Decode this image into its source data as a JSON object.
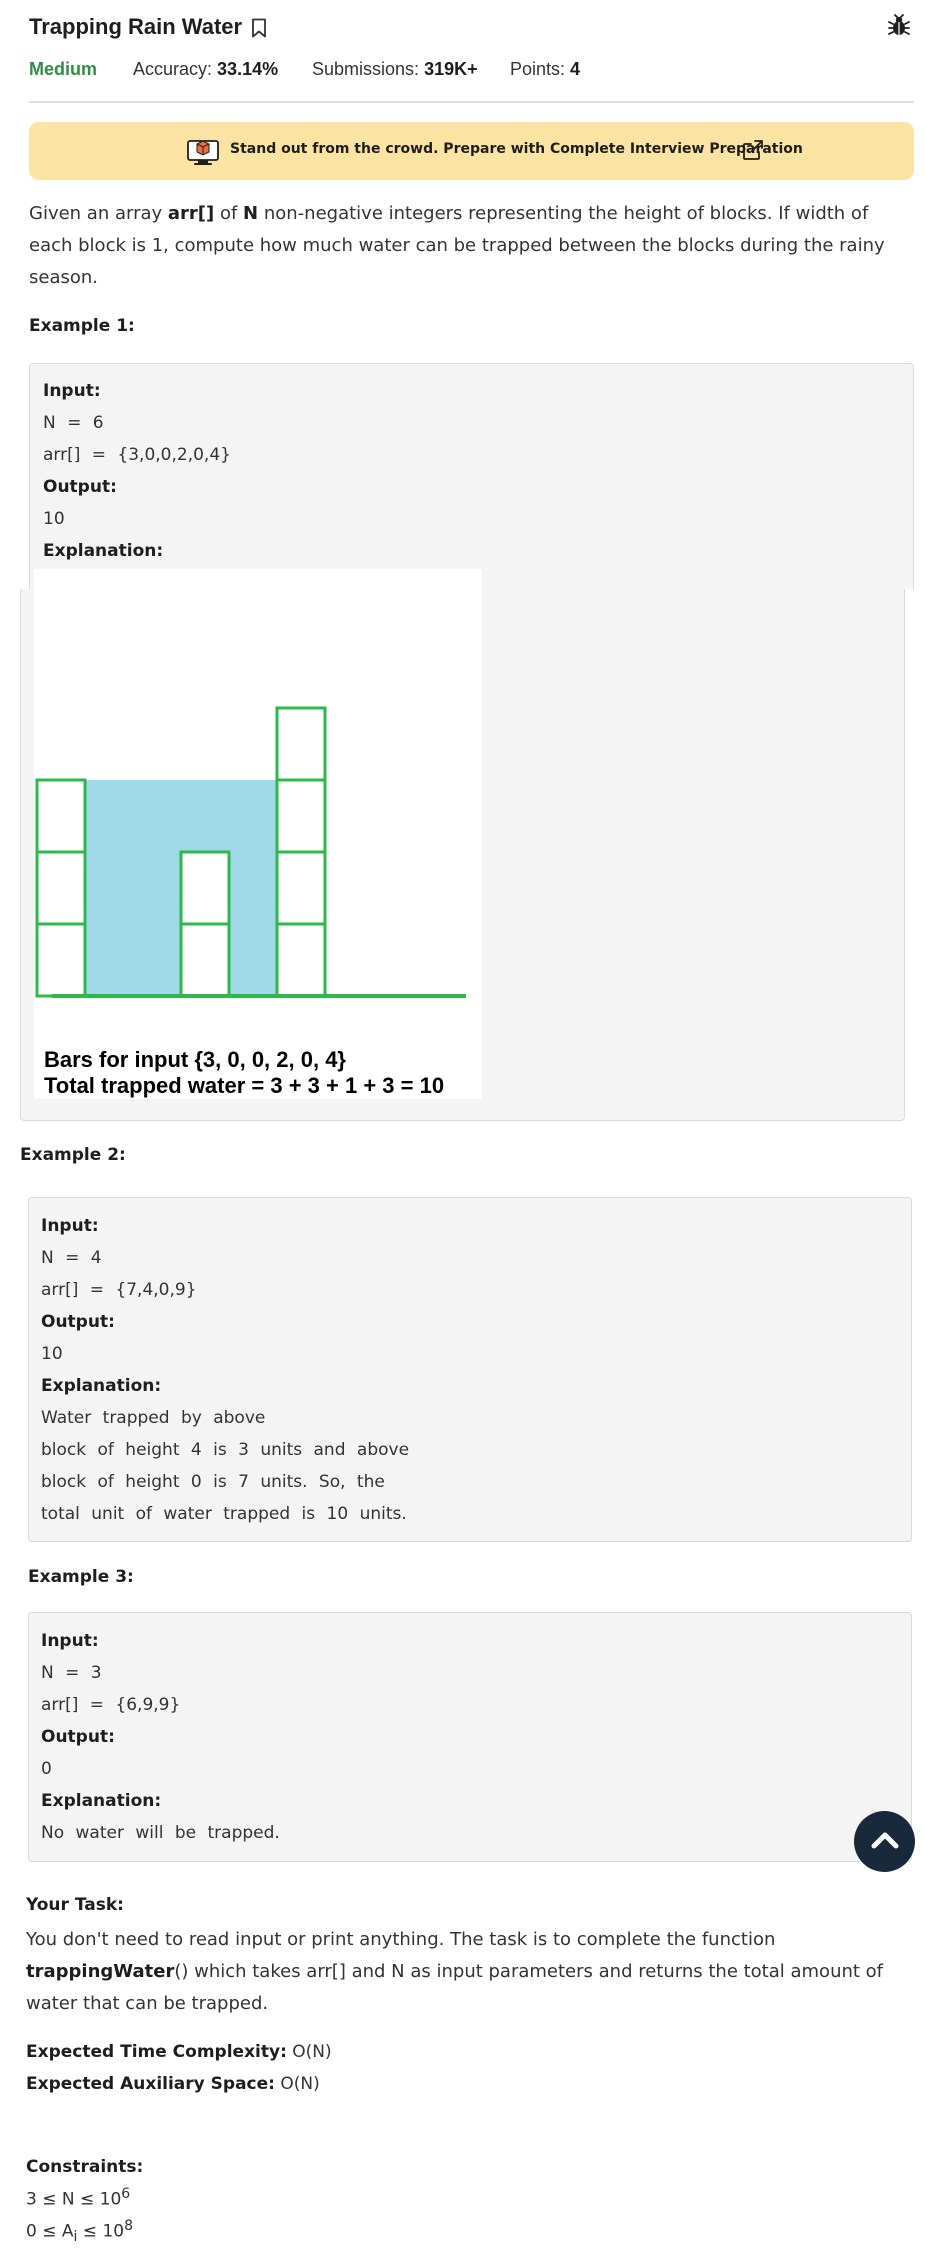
{
  "header": {
    "title": "Trapping Rain Water",
    "difficulty": "Medium",
    "accuracy_label": "Accuracy:",
    "accuracy_value": "33.14%",
    "submissions_label": "Submissions:",
    "submissions_value": "319K+",
    "points_label": "Points:",
    "points_value": "4"
  },
  "banner": {
    "text": "Stand out from the crowd. Prepare with Complete Interview Preparation"
  },
  "description": {
    "part1": "Given an array ",
    "arr": "arr[]",
    "part2": " of ",
    "n": "N",
    "part3": " non-negative integers representing the height of blocks. If width of each block is 1, compute how much water can be trapped between the blocks during the rainy season."
  },
  "labels": {
    "input": "Input:",
    "output": "Output:",
    "explanation": "Explanation:"
  },
  "example1": {
    "title": "Example 1:",
    "n_line": "N = 6",
    "arr_line": "arr[] = {3,0,0,2,0,4}",
    "output": "10",
    "figure": {
      "heights": [
        3,
        0,
        0,
        2,
        0,
        4
      ],
      "water_level": 3,
      "caption1": "Bars for input {3, 0, 0, 2, 0, 4}",
      "caption2": "Total trapped water = 3 + 3 + 1 + 3 = 10",
      "block_color": "#2eb84c",
      "water_color": "#9fd9e8"
    }
  },
  "example2": {
    "title": "Example 2:",
    "n_line": "N = 4",
    "arr_line": "arr[] = {7,4,0,9}",
    "output": "10",
    "explanation_lines": [
      "Water trapped by above",
      "block of height 4 is 3 units and above",
      "block of height 0 is 7 units. So, the",
      "total unit of water trapped is 10 units."
    ]
  },
  "example3": {
    "title": "Example 3:",
    "n_line": "N = 3",
    "arr_line": "arr[] = {6,9,9}",
    "output": "0",
    "explanation": "No water will be trapped."
  },
  "task": {
    "title": "Your Task:",
    "part1": "You don't need to read input or print anything. The task is to complete the function ",
    "function": "trappingWater",
    "part2": "() which takes arr[] and N as input parameters and returns the total amount of water that can be trapped."
  },
  "complexity": {
    "time_label": "Expected Time Complexity:",
    "time_value": "O(N)",
    "space_label": "Expected Auxiliary Space:",
    "space_value": "O(N)"
  },
  "constraints": {
    "title": "Constraints:",
    "c1_pre": "3 ≤ N ≤ 10",
    "c1_exp": "6",
    "c2_a": "0 ≤ A",
    "c2_sub": "i",
    "c2_b": " ≤ 10",
    "c2_exp": "8"
  },
  "icons": {
    "bookmark": "bookmark-icon",
    "bug": "bug-icon",
    "banner": "monitor-icon",
    "external": "external-link-icon",
    "scroll_top": "chevron-up-icon"
  },
  "colors": {
    "accent_green": "#2f8d46",
    "banner_bg": "#fbe3a3",
    "scroll_button": "#17293a"
  }
}
